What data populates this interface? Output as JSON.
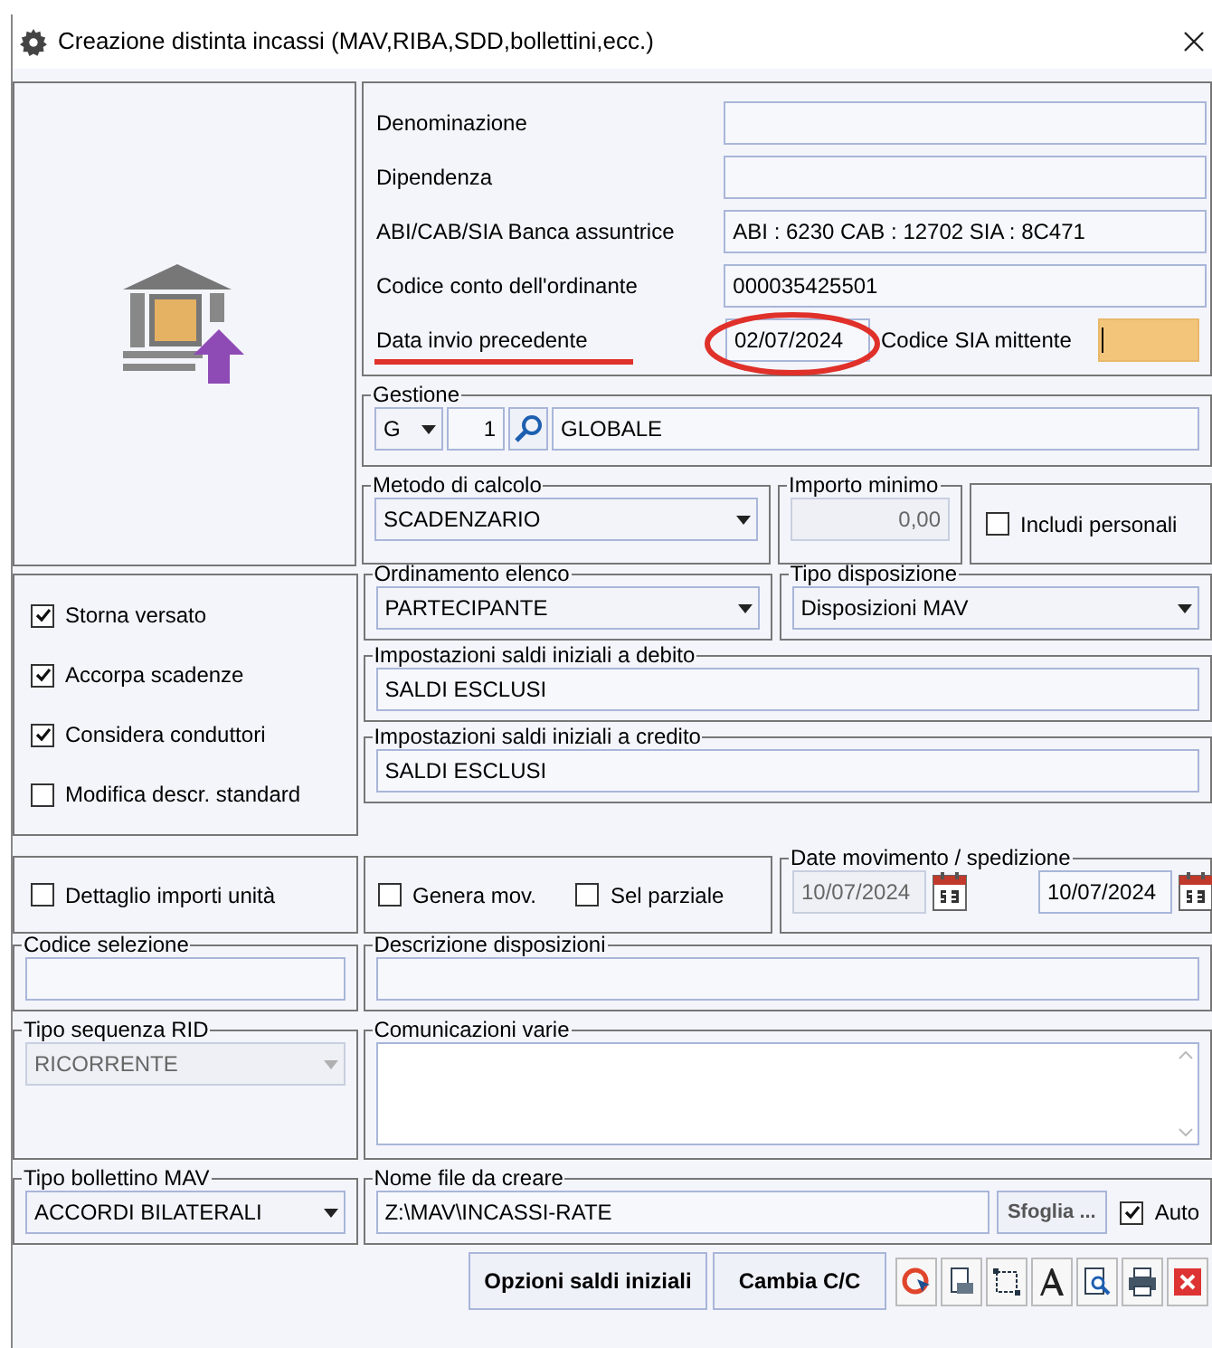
{
  "window": {
    "title": "Creazione distinta incassi (MAV,RIBA,SDD,bollettini,ecc.)"
  },
  "bank_fields": [
    {
      "label": "Denominazione"
    },
    {
      "label": "Dipendenza"
    },
    {
      "label": "ABI/CAB/SIA Banca assuntrice",
      "value": "ABI : 6230 CAB : 12702 SIA : 8C471"
    },
    {
      "label": "Codice conto dell'ordinante",
      "value": "000035425501"
    }
  ],
  "data_invio_precedente": {
    "label": "Data invio precedente",
    "value": "02/07/2024"
  },
  "codice_sia_mittente": {
    "label": "Codice SIA mittente"
  },
  "gestione": {
    "label": "Gestione",
    "type": "G",
    "number": "1",
    "description": "GLOBALE"
  },
  "metodo_di_calcolo": {
    "label": "Metodo di calcolo",
    "value": "SCADENZARIO"
  },
  "importo_minimo": {
    "label": "Importo minimo",
    "value": "0,00",
    "disabled": true
  },
  "includi_personali": {
    "label": "Includi personali",
    "checked": false
  },
  "options": [
    {
      "label": "Storna versato",
      "checked": true
    },
    {
      "label": "Accorpa scadenze",
      "checked": true
    },
    {
      "label": "Considera conduttori",
      "checked": true
    },
    {
      "label": "Modifica descr. standard",
      "checked": false
    }
  ],
  "ordinamento_elenco": {
    "label": "Ordinamento elenco",
    "value": "PARTECIPANTE"
  },
  "tipo_disposizione": {
    "label": "Tipo disposizione",
    "value": "Disposizioni MAV"
  },
  "saldi_debito": {
    "label": "Impostazioni saldi iniziali a debito",
    "value": "SALDI ESCLUSI"
  },
  "saldi_credito": {
    "label": "Impostazioni saldi iniziali a credito",
    "value": "SALDI ESCLUSI"
  },
  "dettaglio_importi_unita": {
    "label": "Dettaglio importi unità",
    "checked": false
  },
  "genera_mov": {
    "label": "Genera mov.",
    "checked": false
  },
  "sel_parziale": {
    "label": "Sel parziale",
    "checked": false
  },
  "date_movimento": {
    "label": "Date movimento / spedizione",
    "dates": [
      {
        "value": "10/07/2024",
        "disabled": true
      },
      {
        "value": "10/07/2024",
        "disabled": false
      }
    ]
  },
  "codice_selezione": {
    "label": "Codice selezione"
  },
  "descrizione_disposizioni": {
    "label": "Descrizione disposizioni"
  },
  "tipo_sequenza_rid": {
    "label": "Tipo sequenza RID",
    "value": "RICORRENTE",
    "disabled": true
  },
  "comunicazioni_varie": {
    "label": "Comunicazioni varie"
  },
  "tipo_bollettino_mav": {
    "label": "Tipo bollettino MAV",
    "value": "ACCORDI BILATERALI"
  },
  "nome_file": {
    "label": "Nome file da creare",
    "value": "Z:\\MAV\\INCASSI-RATE",
    "browse": "Sfoglia ..."
  },
  "auto": {
    "label": "Auto",
    "checked": true
  },
  "buttons": [
    "Opzioni saldi iniziali",
    "Cambia C/C"
  ]
}
